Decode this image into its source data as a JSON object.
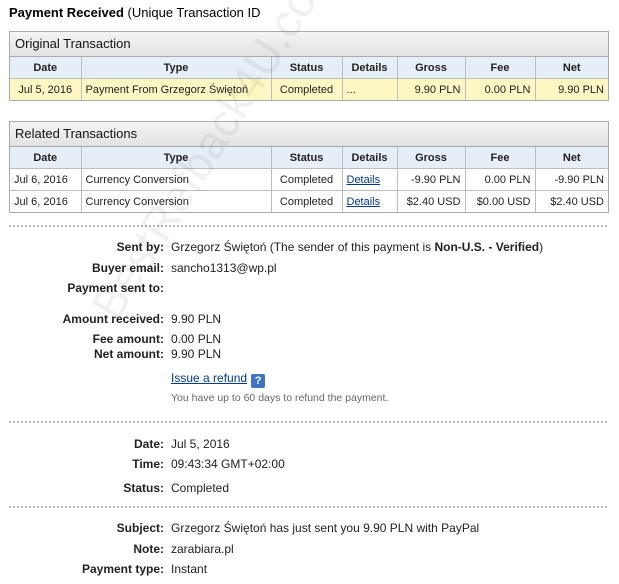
{
  "title": {
    "bold": "Payment Received",
    "rest": " (Unique Transaction ID"
  },
  "columns": [
    "Date",
    "Type",
    "Status",
    "Details",
    "Gross",
    "Fee",
    "Net"
  ],
  "original": {
    "heading": "Original Transaction",
    "rows": [
      {
        "date": "Jul 5, 2016",
        "type": "Payment From Grzegorz Świętoń",
        "status": "Completed",
        "details": "...",
        "gross": "9.90 PLN",
        "fee": "0.00 PLN",
        "net": "9.90 PLN"
      }
    ]
  },
  "related": {
    "heading": "Related Transactions",
    "rows": [
      {
        "date": "Jul 6, 2016",
        "type": "Currency Conversion",
        "status": "Completed",
        "details": "Details",
        "gross": "-9.90 PLN",
        "fee": "0.00 PLN",
        "net": "-9.90 PLN"
      },
      {
        "date": "Jul 6, 2016",
        "type": "Currency Conversion",
        "status": "Completed",
        "details": "Details",
        "gross": "$2.40 USD",
        "fee": "$0.00 USD",
        "net": "$2.40 USD"
      }
    ]
  },
  "sender": {
    "sent_by_label": "Sent by:",
    "sent_by_name": "Grzegorz Świętoń",
    "sent_by_mid": " (The sender of this payment is ",
    "sent_by_status": "Non-U.S. - Verified",
    "sent_by_end": ")",
    "buyer_email_label": "Buyer email:",
    "buyer_email": "sancho1313@wp.pl",
    "payment_sent_to_label": "Payment sent to:",
    "payment_sent_to": ""
  },
  "amounts": {
    "received_label": "Amount received:",
    "received": "9.90 PLN",
    "fee_label": "Fee amount:",
    "fee": "0.00 PLN",
    "net_label": "Net amount:",
    "net": "9.90 PLN",
    "refund_link": "Issue a refund",
    "help_icon": "?",
    "refund_note": "You have up to 60 days to refund the payment."
  },
  "timing": {
    "date_label": "Date:",
    "date": "Jul 5, 2016",
    "time_label": "Time:",
    "time": "09:43:34 GMT+02:00",
    "status_label": "Status:",
    "status": "Completed"
  },
  "extra": {
    "subject_label": "Subject:",
    "subject": "Grzegorz Świętoń has just sent you 9.90 PLN with PayPal",
    "note_label": "Note:",
    "note": "zarabiara.pl",
    "payment_type_label": "Payment type:",
    "payment_type": "Instant"
  },
  "watermark": "BestRefback4U.com"
}
